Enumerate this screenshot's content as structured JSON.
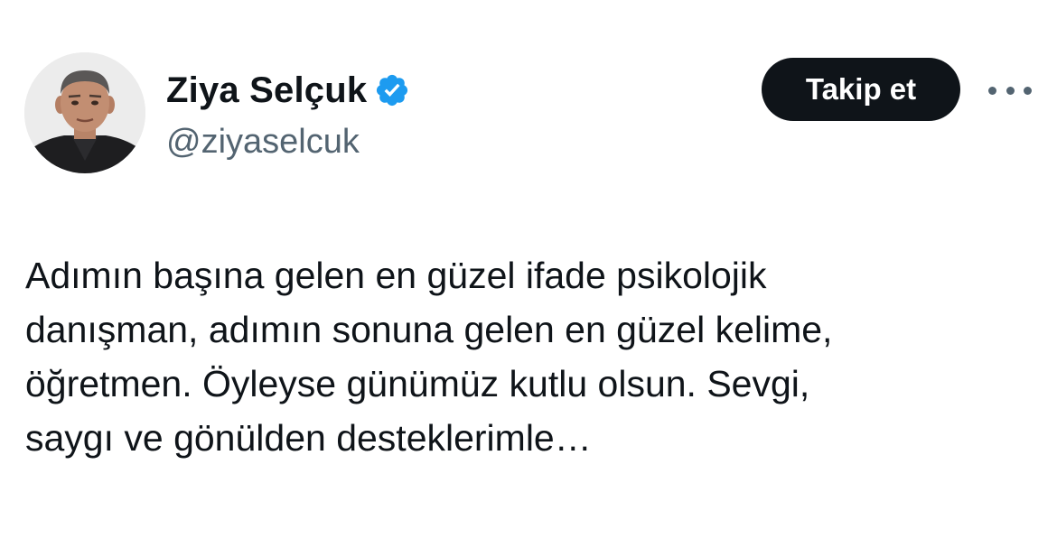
{
  "author": {
    "display_name": "Ziya Selçuk",
    "handle": "@ziyaselcuk",
    "verified": true
  },
  "actions": {
    "follow_label": "Takip et",
    "more_icon": "more-horizontal-icon"
  },
  "tweet": {
    "lines": [
      "Adımın başına gelen en güzel ifade psikolojik",
      "danışman, adımın sonuna gelen en güzel kelime,",
      "öğretmen. Öyleyse günümüz kutlu olsun. Sevgi,",
      "saygı ve gönülden desteklerimle…"
    ]
  },
  "colors": {
    "text_primary": "#0f1419",
    "text_secondary": "#536471",
    "verified_blue": "#1d9bf0",
    "follow_bg": "#0f1419",
    "background": "#ffffff"
  }
}
